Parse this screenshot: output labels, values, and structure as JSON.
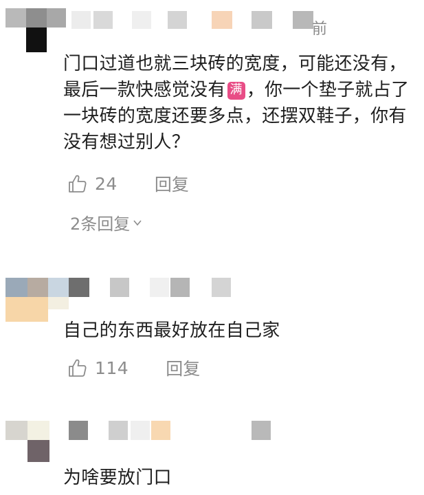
{
  "comments": [
    {
      "time_suffix": "前",
      "text_parts": {
        "before": "门口过道也就三块砖的宽度，可能还没有，最后一款快感觉没有",
        "emoji": "满",
        "after": "，你一个垫子就占了一块砖的宽度还要多点，还摆双鞋子，你有没有想过别人？"
      },
      "likes": "24",
      "reply_label": "回复",
      "more_replies": "2条回复",
      "avatar_tiles": [
        "#b9b9b9",
        "#8e8e8e",
        "#4f4f4f",
        "#111111"
      ],
      "name_tiles": [
        "#9d9d9d",
        "#ececec",
        "#d9d9d9",
        "#efefef",
        "#d4d4d4",
        "#f7d4b7",
        "#c9c9c9",
        "#b8b8b8"
      ]
    },
    {
      "text": "自己的东西最好放在自己家",
      "likes": "114",
      "reply_label": "回复",
      "avatar_tiles": [
        "#9aa9b8",
        "#b7aba1",
        "#c9d6e1",
        "#6e6e6e",
        "#f7d6a8",
        "#f3efe1"
      ],
      "name_tiles": [
        "#c7c7c7",
        "#f0f0f0",
        "#b5b5b5",
        "#d4d4d4"
      ]
    },
    {
      "text": "为啥要放门口",
      "avatar_tiles": [
        "#d7d5cf",
        "#f3f1e3",
        "#6f6368"
      ],
      "name_tiles": [
        "#8b8b8b",
        "#cfcfcf",
        "#efefef",
        "#f8d8b1",
        "#b9b9b9"
      ]
    }
  ]
}
